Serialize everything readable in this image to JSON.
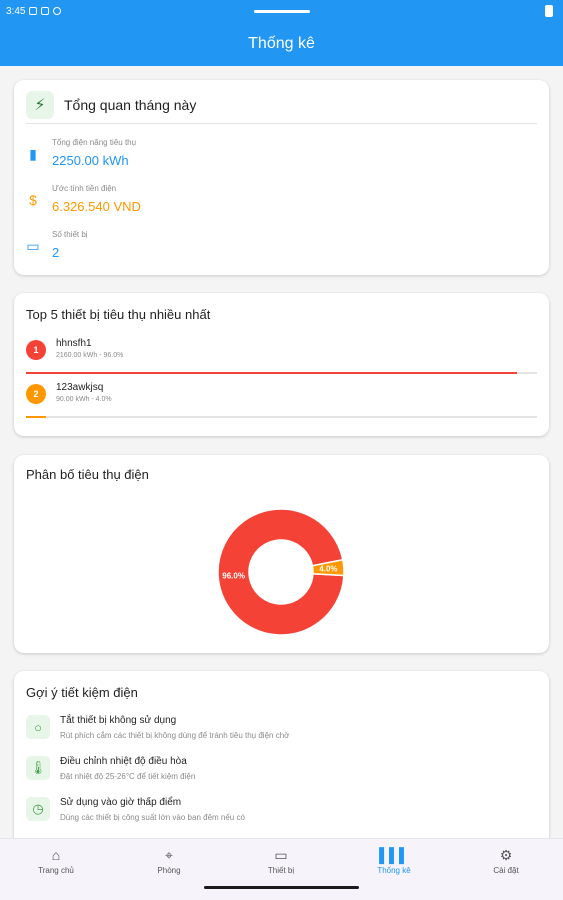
{
  "status_bar": {
    "time": "3:45"
  },
  "app_bar": {
    "title": "Thống kê"
  },
  "overview": {
    "title": "Tổng quan tháng này",
    "stats": [
      {
        "label": "Tổng điện năng tiêu thụ",
        "value": "2250.00 kWh",
        "icon": "battery-icon",
        "color": "#2196f3"
      },
      {
        "label": "Ước tính tiền điện",
        "value": "6.326.540 VND",
        "icon": "dollar-icon",
        "color": "#ff9800"
      },
      {
        "label": "Số thiết bị",
        "value": "2",
        "icon": "device-icon",
        "color": "#2196f3"
      }
    ]
  },
  "top_devices": {
    "title": "Top 5 thiết bị tiêu thụ nhiều nhất",
    "items": [
      {
        "rank": "1",
        "name": "hhnsfh1",
        "detail": "2160.00 kWh - 96.0%",
        "percent": 96.0,
        "color": "#f44336"
      },
      {
        "rank": "2",
        "name": "123awkjsq",
        "detail": "90.00 kWh - 4.0%",
        "percent": 4.0,
        "color": "#ff9800"
      }
    ]
  },
  "distribution": {
    "title": "Phân bố tiêu thụ điện"
  },
  "chart_data": {
    "type": "pie",
    "donut": true,
    "labels": [
      "hhnsfh1",
      "123awkjsq"
    ],
    "values": [
      96.0,
      4.0
    ],
    "data_labels": [
      "96.0%",
      "4.0%"
    ],
    "colors": [
      "#f44336",
      "#ff9800"
    ]
  },
  "tips": {
    "title": "Gợi ý tiết kiệm điện",
    "items": [
      {
        "title": "Tắt thiết bị không sử dụng",
        "desc": "Rút phích cắm các thiết bị không dùng để tránh tiêu thụ điện chờ",
        "icon": "lightbulb-icon"
      },
      {
        "title": "Điều chỉnh nhiệt độ điều hòa",
        "desc": "Đặt nhiệt độ 25-26°C để tiết kiệm điện",
        "icon": "thermometer-icon"
      },
      {
        "title": "Sử dụng vào giờ thấp điểm",
        "desc": "Dùng các thiết bị công suất lớn vào ban đêm nếu có",
        "icon": "clock-icon"
      }
    ]
  },
  "bottom_nav": {
    "items": [
      {
        "label": "Trang chủ",
        "icon": "home-icon",
        "active": false
      },
      {
        "label": "Phòng",
        "icon": "location-icon",
        "active": false
      },
      {
        "label": "Thiết bị",
        "icon": "devices-icon",
        "active": false
      },
      {
        "label": "Thống kê",
        "icon": "chart-icon",
        "active": true
      },
      {
        "label": "Cài đặt",
        "icon": "settings-icon",
        "active": false
      }
    ]
  }
}
